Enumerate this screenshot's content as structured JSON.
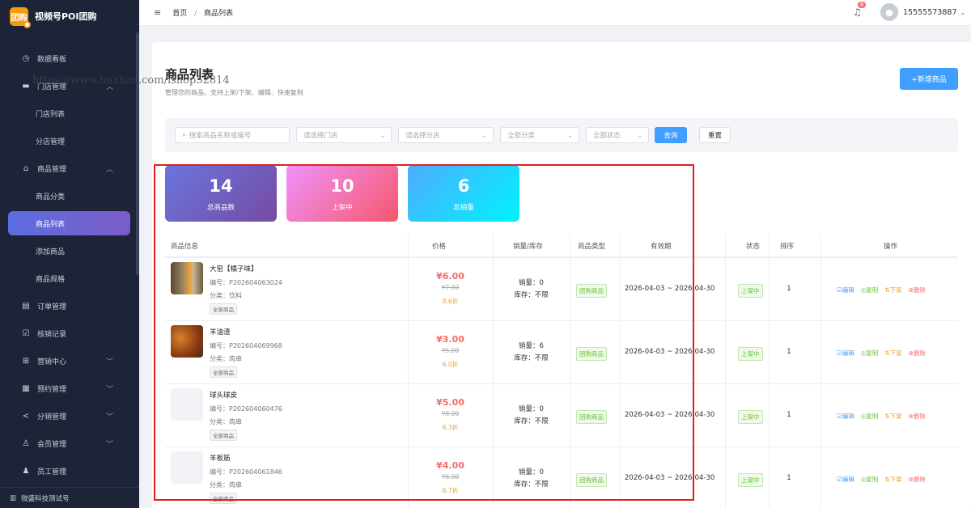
{
  "app": {
    "logo_text": "团购",
    "title": "视频号POI团购"
  },
  "sidebar": {
    "items": [
      {
        "label": "数据看板",
        "icon": "dashboard-icon",
        "glyph": "◷"
      },
      {
        "label": "门店管理",
        "icon": "store-icon",
        "glyph": "▬"
      },
      {
        "label": "门店列表"
      },
      {
        "label": "分店管理"
      },
      {
        "label": "商品管理",
        "icon": "bag-icon",
        "glyph": "⌂"
      },
      {
        "label": "商品分类"
      },
      {
        "label": "商品列表"
      },
      {
        "label": "添加商品"
      },
      {
        "label": "商品规格"
      },
      {
        "label": "订单管理",
        "icon": "order-icon",
        "glyph": "▤"
      },
      {
        "label": "核销记录",
        "icon": "verify-icon",
        "glyph": "☑"
      },
      {
        "label": "营销中心",
        "icon": "marketing-icon",
        "glyph": "⊞"
      },
      {
        "label": "预约管理",
        "icon": "calendar-icon",
        "glyph": "▦"
      },
      {
        "label": "分销管理",
        "icon": "share-icon",
        "glyph": "<"
      },
      {
        "label": "会员管理",
        "icon": "member-icon",
        "glyph": "♙"
      },
      {
        "label": "员工管理",
        "icon": "staff-icon",
        "glyph": "♟"
      }
    ],
    "footer": "微盛科技测试号",
    "chevron_up": "︿",
    "chevron_down": "﹀"
  },
  "header": {
    "menu_icon": "≡",
    "breadcrumb": [
      "首页",
      "商品列表"
    ],
    "breadcrumb_sep": "/",
    "notif_count": "6",
    "username": "15555573887",
    "user_chevron": "⌄"
  },
  "page": {
    "title": "商品列表",
    "subtitle": "管理您的商品，支持上架/下架、编辑、快速复制",
    "add_button": "+新增商品"
  },
  "filters": {
    "search_placeholder": "搜索商品名称或编号",
    "search_icon": "⌕",
    "store_placeholder": "请选择门店",
    "branch_placeholder": "请选择分店",
    "category": "全部分类",
    "status": "全部状态",
    "chevron": "⌄",
    "query": "查询",
    "reset": "重置"
  },
  "stats": [
    {
      "value": "14",
      "label": "总商品数",
      "color1": "#6a75de",
      "color2": "#764ba2"
    },
    {
      "value": "10",
      "label": "上架中",
      "color1": "#f093fb",
      "color2": "#f5576c"
    },
    {
      "value": "6",
      "label": "总销量",
      "color1": "#4facfe",
      "color2": "#00f2fe"
    }
  ],
  "table": {
    "headers": [
      "商品信息",
      "价格",
      "销量/库存",
      "商品类型",
      "有效期",
      "状态",
      "排序",
      "操作"
    ],
    "rows": [
      {
        "name": "大窑【橘子味】",
        "code": "编号：P202604063024",
        "category": "分类：饮料",
        "tag": "全部商品",
        "price": "¥6.00",
        "orig": "¥7.00",
        "discount": "8.6折",
        "sales": "销量：0",
        "stock": "库存：不限",
        "type": "团购商品",
        "validity": "2026-04-03 ~ 2026-04-30",
        "status": "上架中",
        "sort": "1",
        "thumb": "drink"
      },
      {
        "name": "羊油渣",
        "code": "编号：P202604069968",
        "category": "分类：肉串",
        "tag": "全部商品",
        "price": "¥3.00",
        "orig": "¥5.00",
        "discount": "6.0折",
        "sales": "销量：6",
        "stock": "库存：不限",
        "type": "团购商品",
        "validity": "2026-04-03 ~ 2026-04-30",
        "status": "上架中",
        "sort": "1",
        "thumb": "skewer"
      },
      {
        "name": "球头球皮",
        "code": "编号：P202604060476",
        "category": "分类：肉串",
        "tag": "全部商品",
        "price": "¥5.00",
        "orig": "¥8.00",
        "discount": "6.3折",
        "sales": "销量：0",
        "stock": "库存：不限",
        "type": "团购商品",
        "validity": "2026-04-03 ~ 2026-04-30",
        "status": "上架中",
        "sort": "1",
        "thumb": "none"
      },
      {
        "name": "羊板筋",
        "code": "编号：P202604061846",
        "category": "分类：肉串",
        "tag": "全部商品",
        "price": "¥4.00",
        "orig": "¥6.00",
        "discount": "6.7折",
        "sales": "销量：0",
        "stock": "库存：不限",
        "type": "团购商品",
        "validity": "2026-04-03 ~ 2026-04-30",
        "status": "上架中",
        "sort": "1",
        "thumb": "none"
      }
    ],
    "ops": {
      "edit": "☑编辑",
      "copy": "◎复制",
      "down": "⇅下架",
      "delete": "⊗删除"
    }
  },
  "watermark": "https://www.huzhan.com/ishop52814"
}
